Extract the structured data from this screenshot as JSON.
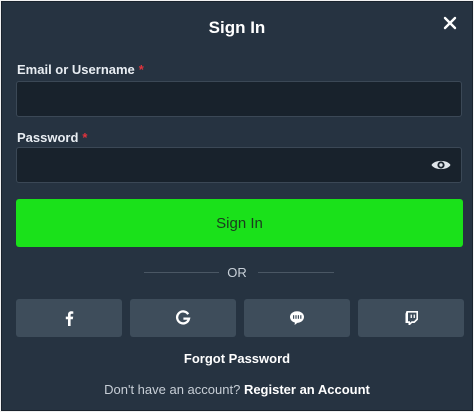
{
  "dialog": {
    "title": "Sign In",
    "close_icon": "close-icon"
  },
  "form": {
    "email_label": "Email or Username",
    "email_required": "*",
    "email_value": "",
    "password_label": "Password",
    "password_required": "*",
    "password_value": "",
    "password_toggle_icon": "eye-icon",
    "submit_label": "Sign In"
  },
  "divider": {
    "label": "OR"
  },
  "social_buttons": [
    {
      "icon": "facebook-icon"
    },
    {
      "icon": "google-icon"
    },
    {
      "icon": "line-icon"
    },
    {
      "icon": "twitch-icon"
    }
  ],
  "footer": {
    "forgot_label": "Forgot Password",
    "register_prompt": "Don't have an account?",
    "register_label": "Register an Account"
  },
  "colors": {
    "background": "#263341",
    "input_background": "#18222c",
    "primary_button": "#1ae11a",
    "social_button": "#3e4d5b",
    "required_marker": "#e0333c"
  }
}
